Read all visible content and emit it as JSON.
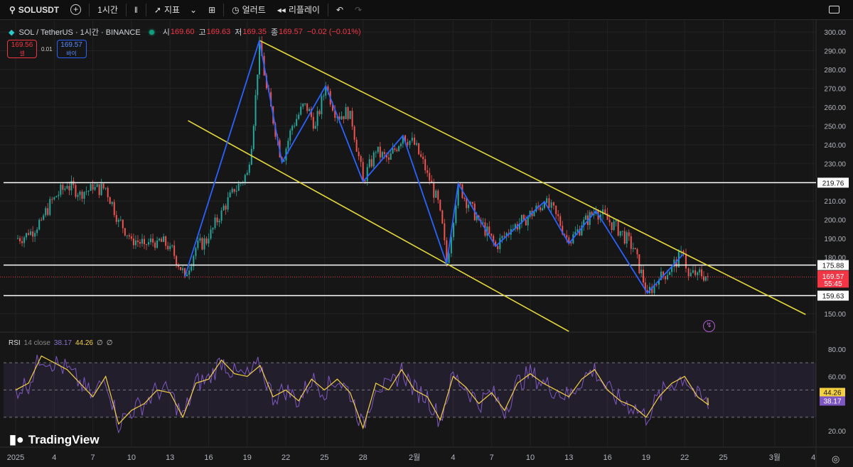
{
  "toolbar": {
    "symbol": "SOLUSDT",
    "interval": "1시간",
    "indicators": "지표",
    "alert": "얼러트",
    "replay": "리플레이"
  },
  "legend": {
    "title": "SOL / TetherUS · 1시간 · BINANCE",
    "o_label": "시",
    "o": "169.60",
    "h_label": "고",
    "h": "169.63",
    "l_label": "저",
    "l": "169.35",
    "c_label": "종",
    "c": "169.57",
    "change": "−0.02 (−0.01%)"
  },
  "quotes": {
    "sell": "169.56",
    "sell_label": "셀",
    "spread": "0.01",
    "buy": "169.57",
    "buy_label": "바이"
  },
  "rsi_legend": {
    "name": "RSI",
    "params": "14 close",
    "rsi": "38.17",
    "ma": "44.26",
    "extra1": "∅",
    "extra2": "∅"
  },
  "brand": "TradingView",
  "colors": {
    "up": "#26a69a",
    "down": "#ef5350",
    "zigzag": "#2962ff",
    "channel": "#e5d93c",
    "rsi": "#7e57c2",
    "rsi_ma": "#f5d142",
    "last": "#f23645"
  },
  "chart_data": {
    "type": "candlestick",
    "title": "SOL / TetherUS · 1시간 · BINANCE",
    "x_unit": "days since 2025-01-01",
    "price_axis": {
      "ylim": [
        145,
        305
      ],
      "ticks": [
        "300.00",
        "290.00",
        "280.00",
        "270.00",
        "260.00",
        "250.00",
        "240.00",
        "230.00",
        "210.00",
        "200.00",
        "190.00",
        "180.00",
        "150.00"
      ]
    },
    "x_ticks": [
      {
        "d": 0,
        "label": "2025"
      },
      {
        "d": 3,
        "label": "4"
      },
      {
        "d": 6,
        "label": "7"
      },
      {
        "d": 9,
        "label": "10"
      },
      {
        "d": 12,
        "label": "13"
      },
      {
        "d": 15,
        "label": "16"
      },
      {
        "d": 18,
        "label": "19"
      },
      {
        "d": 21,
        "label": "22"
      },
      {
        "d": 24,
        "label": "25"
      },
      {
        "d": 27,
        "label": "28"
      },
      {
        "d": 31,
        "label": "2월"
      },
      {
        "d": 34,
        "label": "4"
      },
      {
        "d": 37,
        "label": "7"
      },
      {
        "d": 40,
        "label": "10"
      },
      {
        "d": 43,
        "label": "13"
      },
      {
        "d": 46,
        "label": "16"
      },
      {
        "d": 49,
        "label": "19"
      },
      {
        "d": 52,
        "label": "22"
      },
      {
        "d": 55,
        "label": "25"
      },
      {
        "d": 59,
        "label": "3월"
      },
      {
        "d": 62,
        "label": "4"
      }
    ],
    "closes": [
      [
        0,
        190
      ],
      [
        1,
        192
      ],
      [
        2,
        200
      ],
      [
        3,
        212
      ],
      [
        4,
        218
      ],
      [
        5,
        215
      ],
      [
        6,
        216
      ],
      [
        7,
        217
      ],
      [
        8,
        200
      ],
      [
        9,
        190
      ],
      [
        10,
        187
      ],
      [
        11,
        189
      ],
      [
        12,
        186
      ],
      [
        13.15,
        170
      ],
      [
        14,
        185
      ],
      [
        15,
        190
      ],
      [
        16,
        205
      ],
      [
        17,
        215
      ],
      [
        18,
        225
      ],
      [
        18.5,
        250
      ],
      [
        18.95,
        295
      ],
      [
        19.5,
        270
      ],
      [
        20.7,
        231
      ],
      [
        21.5,
        250
      ],
      [
        22.5,
        262
      ],
      [
        23.3,
        250
      ],
      [
        24.1,
        271
      ],
      [
        25,
        255
      ],
      [
        26,
        258
      ],
      [
        27,
        221
      ],
      [
        28,
        236
      ],
      [
        29,
        232
      ],
      [
        30.1,
        245
      ],
      [
        31,
        240
      ],
      [
        32,
        225
      ],
      [
        33,
        205
      ],
      [
        33.5,
        177
      ],
      [
        34.4,
        219
      ],
      [
        35.2,
        208
      ],
      [
        36,
        200
      ],
      [
        37.3,
        186
      ],
      [
        38.5,
        195
      ],
      [
        39.5,
        200
      ],
      [
        41.1,
        209
      ],
      [
        42,
        203
      ],
      [
        43,
        188
      ],
      [
        44,
        197
      ],
      [
        45.1,
        205
      ],
      [
        46,
        200
      ],
      [
        47,
        194
      ],
      [
        48,
        185
      ],
      [
        49.1,
        161
      ],
      [
        50,
        168
      ],
      [
        51,
        175
      ],
      [
        51.9,
        182
      ],
      [
        52.3,
        170
      ],
      [
        53,
        172
      ],
      [
        53.8,
        169.57
      ]
    ],
    "horizontal_levels": [
      {
        "price": 219.76,
        "label": "219.76"
      },
      {
        "price": 175.88,
        "label": "175.88"
      },
      {
        "price": 159.63,
        "label": "159.63"
      }
    ],
    "last_price": {
      "price": 169.57,
      "label": "169.57",
      "countdown": "55:45"
    },
    "zigzag": [
      [
        13.15,
        169.7
      ],
      [
        18.95,
        295.5
      ],
      [
        20.7,
        230.5
      ],
      [
        24.1,
        271.3
      ],
      [
        27,
        220.3
      ],
      [
        30.1,
        244.8
      ],
      [
        33.5,
        176.5
      ],
      [
        34.4,
        219.2
      ],
      [
        37.3,
        185.9
      ],
      [
        41.1,
        209.7
      ],
      [
        43,
        187.4
      ],
      [
        45.1,
        204.8
      ],
      [
        49.1,
        161
      ],
      [
        51.9,
        181.8
      ]
    ],
    "channel_lines": [
      [
        [
          18.95,
          295.5
        ],
        [
          61.4,
          149.6
        ]
      ],
      [
        [
          13.4,
          252.8
        ],
        [
          43,
          140.6
        ]
      ]
    ],
    "rsi": {
      "ylim": [
        10,
        90
      ],
      "ticks": [
        "80.00",
        "60.00",
        "20.00"
      ],
      "bands": [
        70,
        50,
        30
      ],
      "last": "38.17",
      "ma_last": "44.26",
      "values": [
        50,
        55,
        75,
        70,
        65,
        55,
        45,
        60,
        25,
        35,
        40,
        50,
        48,
        30,
        55,
        58,
        72,
        62,
        60,
        68,
        45,
        50,
        42,
        58,
        50,
        58,
        48,
        22,
        55,
        50,
        65,
        50,
        45,
        28,
        60,
        52,
        40,
        48,
        35,
        55,
        62,
        55,
        50,
        45,
        58,
        65,
        50,
        42,
        38,
        30,
        45,
        55,
        60,
        45,
        38
      ]
    }
  }
}
